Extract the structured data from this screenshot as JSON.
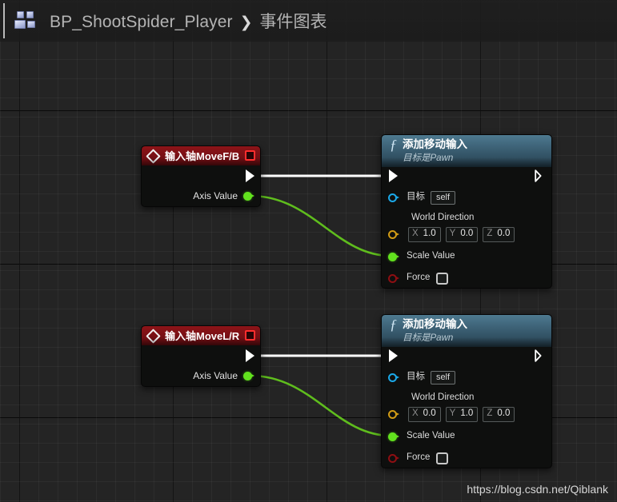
{
  "breadcrumb": {
    "icon": "blueprint-icon",
    "blueprint_name": "BP_ShootSpider_Player",
    "separator": "❯",
    "graph_name": "事件图表"
  },
  "watermark": "https://blog.csdn.net/Qiblank",
  "colors": {
    "canvas_bg": "#242424",
    "event_node_header": "#7b1015",
    "function_node_header": "#3d6277",
    "exec_wire": "#ffffff",
    "float_wire": "#62e21e",
    "pin_green": "#62e21e",
    "pin_blue": "#1ba8e8",
    "pin_yellow": "#d19b15",
    "pin_red": "#8e0e12"
  },
  "nodes": {
    "event_fb": {
      "title": "输入轴MoveF/B",
      "icon": "diamond-event-icon",
      "badge": "red-square-icon",
      "exec_out_label": "",
      "axis_value_label": "Axis Value"
    },
    "event_lr": {
      "title": "输入轴MoveL/R",
      "icon": "diamond-event-icon",
      "badge": "red-square-icon",
      "exec_out_label": "",
      "axis_value_label": "Axis Value"
    },
    "add_movement_1": {
      "title": "添加移动输入",
      "subtitle": "目标是Pawn",
      "icon": "function-f-icon",
      "target_label": "目标",
      "target_value": "self",
      "world_direction_label": "World Direction",
      "world_direction": {
        "x_label": "X",
        "x": "1.0",
        "y_label": "Y",
        "y": "0.0",
        "z_label": "Z",
        "z": "0.0"
      },
      "scale_value_label": "Scale Value",
      "force_label": "Force",
      "force_checked": false
    },
    "add_movement_2": {
      "title": "添加移动输入",
      "subtitle": "目标是Pawn",
      "icon": "function-f-icon",
      "target_label": "目标",
      "target_value": "self",
      "world_direction_label": "World Direction",
      "world_direction": {
        "x_label": "X",
        "x": "0.0",
        "y_label": "Y",
        "y": "1.0",
        "z_label": "Z",
        "z": "0.0"
      },
      "scale_value_label": "Scale Value",
      "force_label": "Force",
      "force_checked": false
    }
  }
}
